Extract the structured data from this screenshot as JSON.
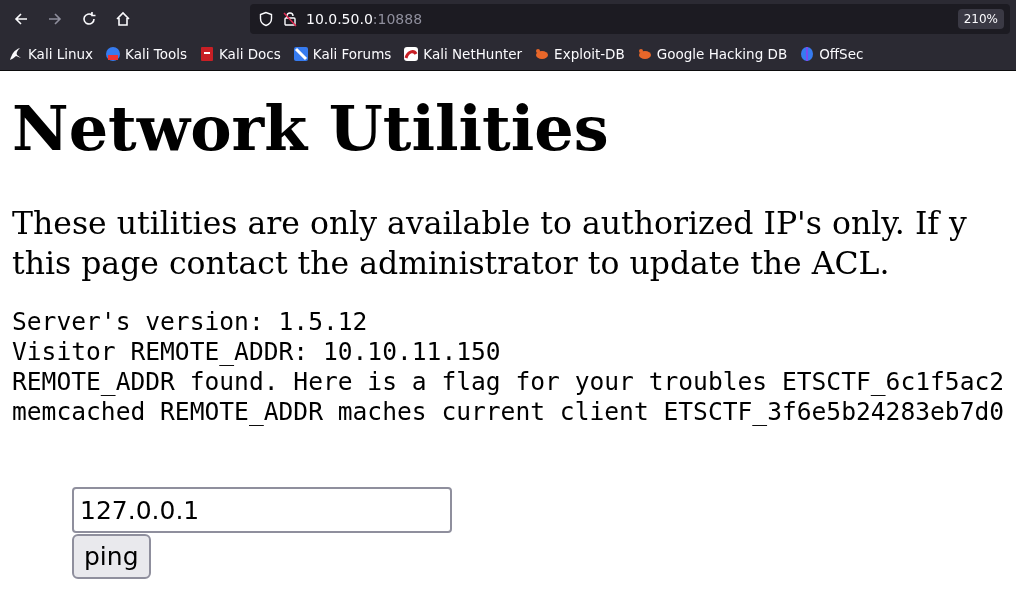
{
  "browser": {
    "url_host": "10.0.50.0",
    "url_port": ":10888",
    "zoom": "210%",
    "forward_disabled": true,
    "bookmarks": [
      {
        "label": "Kali Linux"
      },
      {
        "label": "Kali Tools"
      },
      {
        "label": "Kali Docs"
      },
      {
        "label": "Kali Forums"
      },
      {
        "label": "Kali NetHunter"
      },
      {
        "label": "Exploit-DB"
      },
      {
        "label": "Google Hacking DB"
      },
      {
        "label": "OffSec"
      }
    ]
  },
  "page": {
    "heading": "Network Utilities",
    "intro_lines": [
      "These utilities are only available to authorized IP's only. If y",
      "this page contact the administrator to update the ACL."
    ],
    "output_lines": [
      "Server's version: 1.5.12",
      "Visitor REMOTE_ADDR: 10.10.11.150",
      "REMOTE_ADDR found. Here is a flag for your troubles ETSCTF_6c1f5ac2",
      "memcached REMOTE_ADDR maches current client ETSCTF_3f6e5b24283eb7d0"
    ],
    "host_field": {
      "value": "127.0.0.1"
    },
    "button": "ping"
  }
}
